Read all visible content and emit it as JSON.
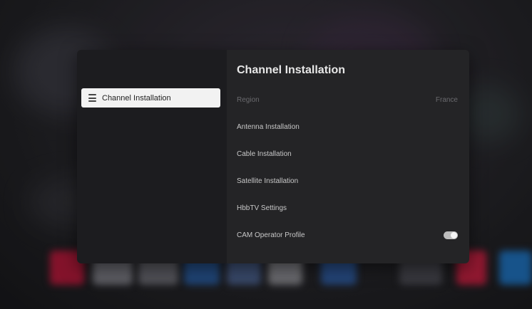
{
  "sidebar": {
    "items": [
      {
        "label": "Channel Installation",
        "icon": "list-icon",
        "selected": true
      }
    ]
  },
  "panel": {
    "title": "Channel Installation",
    "region": {
      "label": "Region",
      "value": "France",
      "disabled": true
    },
    "items": [
      {
        "label": "Antenna Installation"
      },
      {
        "label": "Cable Installation"
      },
      {
        "label": "Satellite Installation"
      },
      {
        "label": "HbbTV Settings"
      },
      {
        "label": "CAM Operator Profile",
        "toggle": "on"
      }
    ]
  },
  "colors": {
    "sidebar_bg": "#1c1c1f",
    "panel_bg": "#242426",
    "selected_bg": "#f2f2f2"
  }
}
